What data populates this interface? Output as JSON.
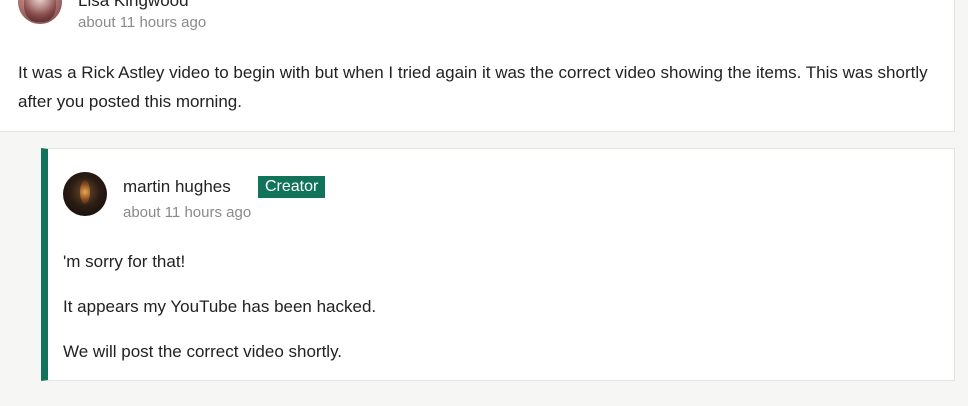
{
  "parent_comment": {
    "author": "Lisa Kingwood",
    "timestamp": "about 11 hours ago",
    "body": "It was a Rick Astley video to begin with but when I tried again it was the correct video showing the items. This was shortly after you posted this morning."
  },
  "reply": {
    "author": "martin hughes",
    "badge": "Creator",
    "timestamp": "about 11 hours ago",
    "paragraphs": [
      "'m sorry for that!",
      "It appears my YouTube has been hacked.",
      "We will post the correct video shortly."
    ]
  },
  "colors": {
    "accent": "#10735a",
    "muted_text": "#8a8a8a",
    "background": "#f6f6f4"
  }
}
